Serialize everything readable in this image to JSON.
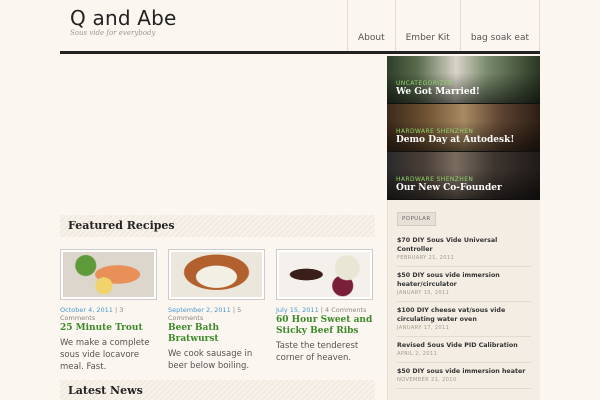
{
  "site": {
    "title": "Q and Abe",
    "tagline": "Sous vide for everybody"
  },
  "nav": [
    "About",
    "Ember Kit",
    "bag soak eat"
  ],
  "slides": [
    {
      "category": "Uncategorized",
      "title": "We Got Married!"
    },
    {
      "category": "Hardware Shenzhen",
      "title": "Demo Day at Autodesk!"
    },
    {
      "category": "Hardware Shenzhen",
      "title": "Our New Co-Founder"
    }
  ],
  "featured": {
    "heading": "Featured Recipes",
    "recipes": [
      {
        "date": "October 4, 2011",
        "comments": "3 Comments",
        "title": "25 Minute Trout",
        "excerpt": "We make a complete sous vide locavore meal. Fast."
      },
      {
        "date": "September 2, 2011",
        "comments": "5 Comments",
        "title": "Beer Bath Bratwurst",
        "excerpt": "We cook sausage in beer below boiling."
      },
      {
        "date": "July 15, 2011",
        "comments": "4 Comments",
        "title": "60 Hour Sweet and Sticky Beef Ribs",
        "excerpt": "Taste the tenderest corner of heaven."
      }
    ]
  },
  "latest": {
    "heading": "Latest News"
  },
  "sidebar": {
    "tab": "Popular",
    "items": [
      {
        "title": "$70 DIY Sous Vide Universal Controller",
        "date": "February 21, 2011"
      },
      {
        "title": "$50 DIY sous vide immersion heater/circulator",
        "date": "January 15, 2011"
      },
      {
        "title": "$100 DIY cheese vat/sous vide circulating water oven",
        "date": "January 17, 2011"
      },
      {
        "title": "Revised Sous Vide PID Calibration",
        "date": "April 2, 2011"
      },
      {
        "title": "$50 DIY sous vide immersion heater",
        "date": "November 21, 2010"
      }
    ]
  }
}
